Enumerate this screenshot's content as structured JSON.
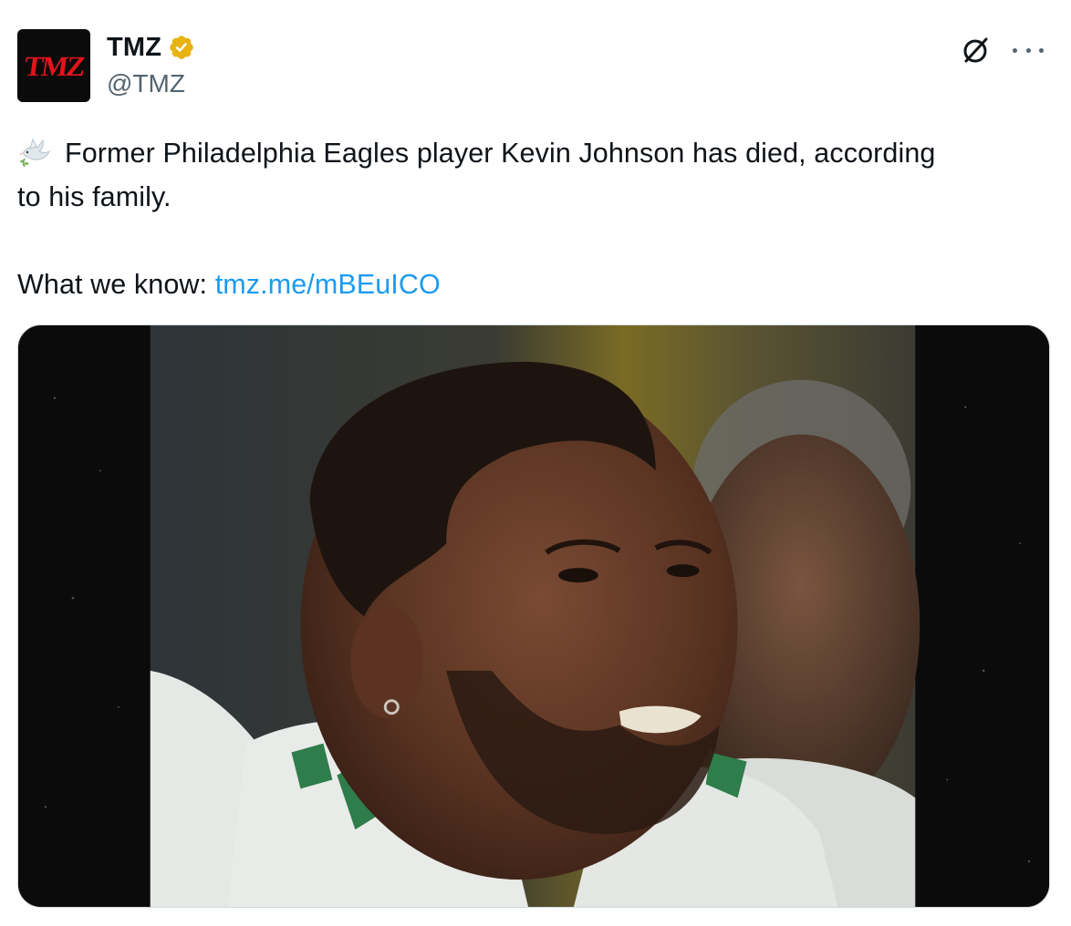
{
  "account": {
    "display_name": "TMZ",
    "handle": "@TMZ",
    "avatar_logo_text": "TMZ",
    "verified_badge_color": "#f4b400"
  },
  "tweet": {
    "emoji": "dove-of-peace-icon",
    "line1": "Former Philadelphia Eagles player Kevin Johnson has died, according",
    "line2": "to his family.",
    "what_we_know_label": "What we know: ",
    "link_text": "tmz.me/mBEuICO"
  },
  "media": {
    "image_description_icon": "photo-image"
  },
  "colors": {
    "link": "#1d9bf0",
    "text": "#0f1419",
    "secondary_text": "#536471",
    "brand_red": "#e3141b"
  }
}
